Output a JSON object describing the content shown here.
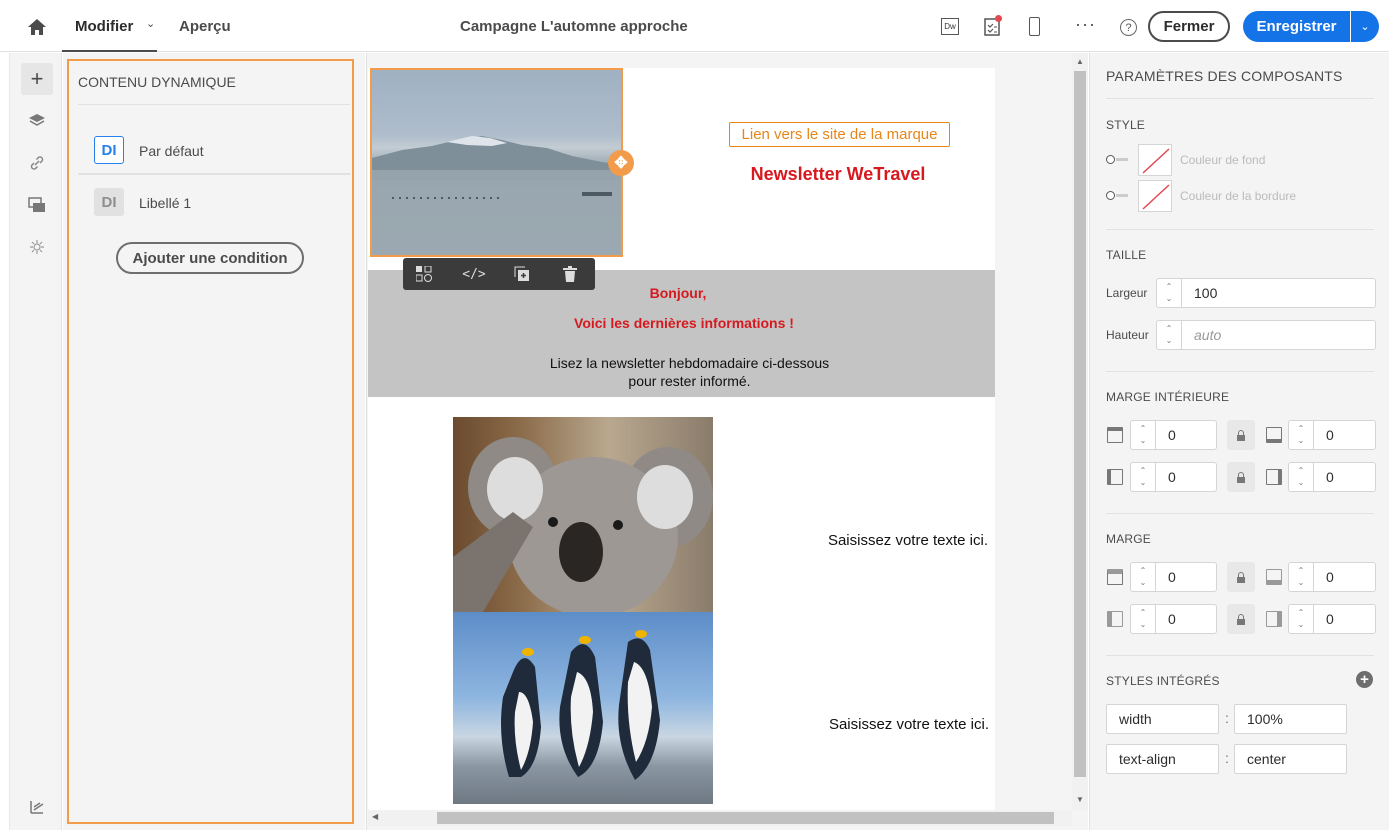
{
  "header": {
    "tab_modify": "Modifier",
    "tab_preview": "Aperçu",
    "campaign_title": "Campagne L'automne approche",
    "dw_label": "Dw",
    "close_button": "Fermer",
    "save_button": "Enregistrer"
  },
  "dynamic_panel": {
    "title": "CONTENU DYNAMIQUE",
    "items": [
      {
        "badge": "DI",
        "label": "Par défaut"
      },
      {
        "badge": "DI",
        "label": "Libellé 1"
      }
    ],
    "add_condition": "Ajouter une condition"
  },
  "email": {
    "brand_link": "Lien vers le site de la marque",
    "newsletter_title": "Newsletter WeTravel",
    "greeting": "Bonjour,",
    "news_line": "Voici les dernières informations !",
    "intro_line1": "Lisez la newsletter hebdomadaire ci-dessous",
    "intro_line2": "pour rester informé.",
    "placeholder_text_1": "Saisissez votre texte ici.",
    "placeholder_text_2": "Saisissez votre texte ici."
  },
  "component_settings": {
    "title": "PARAMÈTRES DES COMPOSANTS",
    "style_title": "STYLE",
    "bg_color_label": "Couleur de fond",
    "border_color_label": "Couleur de la bordure",
    "size_title": "TAILLE",
    "width_label": "Largeur",
    "width_value": "100",
    "height_label": "Hauteur",
    "height_placeholder": "auto",
    "padding_title": "MARGE INTÉRIEURE",
    "padding_top": "0",
    "padding_bottom": "0",
    "padding_left": "0",
    "padding_right": "0",
    "margin_title": "MARGE",
    "margin_top": "0",
    "margin_bottom": "0",
    "margin_left": "0",
    "margin_right": "0",
    "inline_styles_title": "STYLES INTÉGRÉS",
    "inline_styles": [
      {
        "property": "width",
        "value": "100%"
      },
      {
        "property": "text-align",
        "value": "center"
      }
    ],
    "separator": ":"
  },
  "colors": {
    "accent_blue": "#1473e6",
    "orange_selection": "#f29b4b",
    "brand_red": "#d7191f",
    "brand_orange": "#e68619",
    "grey_band": "#c4c4c4"
  }
}
